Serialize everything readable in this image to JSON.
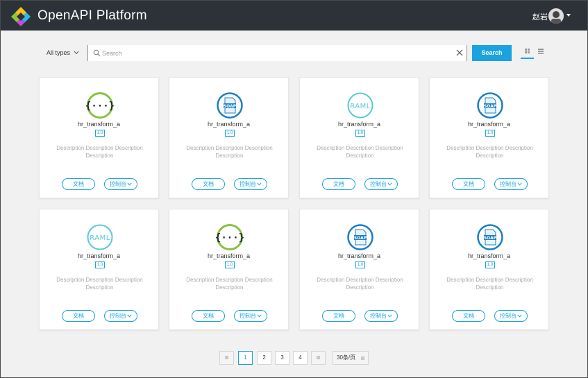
{
  "header": {
    "title": "OpenAPI Platform",
    "user_name": "赵岩"
  },
  "toolbar": {
    "type_filter": "All types",
    "search_placeholder": "Search",
    "search_button": "Search"
  },
  "cards": [
    {
      "icon": "swagger-icon",
      "title": "hr_transform_a",
      "version": "1.0",
      "description": "Description Description Description Description",
      "doc_label": "文档",
      "console_label": "控制台"
    },
    {
      "icon": "soap-icon",
      "title": "hr_transform_a",
      "version": "1.0",
      "description": "Description Description Description Description",
      "doc_label": "文档",
      "console_label": "控制台"
    },
    {
      "icon": "raml-icon",
      "title": "hr_transform_a",
      "version": "1.0",
      "description": "Description Description Description Description",
      "doc_label": "文档",
      "console_label": "控制台"
    },
    {
      "icon": "soap-icon",
      "title": "hr_transform_a",
      "version": "1.0",
      "description": "Description Description Description Description",
      "doc_label": "文档",
      "console_label": "控制台"
    },
    {
      "icon": "raml-icon",
      "title": "hr_transform_a",
      "version": "1.0",
      "description": "Description Description Description Description",
      "doc_label": "文档",
      "console_label": "控制台"
    },
    {
      "icon": "swagger-icon",
      "title": "hr_transform_a",
      "version": "1.0",
      "description": "Description Description Description Description",
      "doc_label": "文档",
      "console_label": "控制台"
    },
    {
      "icon": "soap-icon",
      "title": "hr_transform_a",
      "version": "1.0",
      "description": "Description Description Description Description",
      "doc_label": "文档",
      "console_label": "控制台"
    },
    {
      "icon": "soap-icon",
      "title": "hr_transform_a",
      "version": "1.0",
      "description": "Description Description Description Description",
      "doc_label": "文档",
      "console_label": "控制台"
    }
  ],
  "pagination": {
    "pages": [
      "1",
      "2",
      "3",
      "4"
    ],
    "current": "1",
    "page_size": "30条/页"
  },
  "colors": {
    "header_bg": "#2d3238",
    "accent": "#1aa3e0",
    "swagger_green": "#85c13f",
    "raml_teal": "#5bc8d8",
    "soap_blue": "#1a7ec4"
  }
}
